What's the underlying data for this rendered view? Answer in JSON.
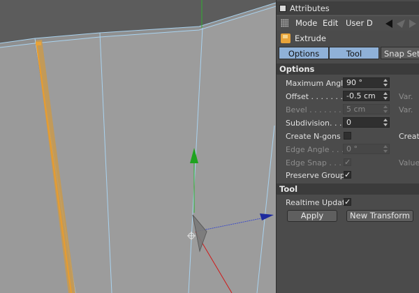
{
  "viewport": {
    "colors": {
      "background": "#5c5c5c",
      "wall": "#9a9a9a",
      "wire": "#a9d3f0",
      "selected_edge": "#e89c2f",
      "y_axis": "#1fa31f",
      "x_axis": "#1d2a9e",
      "z_axis": "#d01818"
    }
  },
  "attributes": {
    "title": "Attributes",
    "menu": {
      "mode": "Mode",
      "edit": "Edit",
      "user_data": "User D"
    },
    "object_name": "Extrude",
    "object_icon": "extrude-icon",
    "tabs": [
      "Options",
      "Tool",
      "Snap Setti"
    ],
    "options_header": "Options",
    "options": {
      "maximum_angle": {
        "label": "Maximum Angle",
        "value": "90 °"
      },
      "offset": {
        "label": "Offset . . . . . . . .",
        "value": "-0.5 cm",
        "var_label": "Var."
      },
      "bevel": {
        "label": "Bevel . . . . . . . .",
        "value": "5 cm",
        "var_label": "Var."
      },
      "subdivision": {
        "label": "Subdivision. . . .",
        "value": "0"
      },
      "create_ngons": {
        "label": "Create N-gons .",
        "checked": false,
        "right_label": "Create"
      },
      "edge_angle": {
        "label": "Edge Angle . . .",
        "value": "0 °"
      },
      "edge_snap": {
        "label": "Edge Snap . . . .",
        "checked": true,
        "right_label": "Value"
      },
      "preserve_groups": {
        "label": "Preserve Groups",
        "checked": true
      }
    },
    "tool_header": "Tool",
    "tool": {
      "realtime_update": {
        "label": "Realtime Update",
        "checked": true
      },
      "apply_label": "Apply",
      "new_transform_label": "New Transform"
    },
    "colors": {
      "panel": "#4b4b4b",
      "active_tab": "#8fb1d8",
      "section": "#3b3b3b"
    }
  }
}
